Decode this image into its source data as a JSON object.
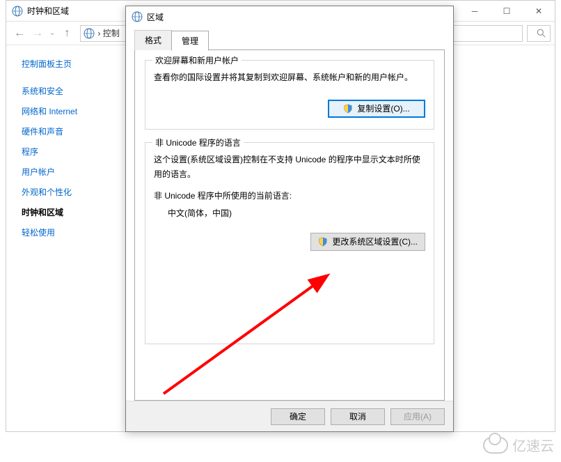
{
  "cp": {
    "title": "时钟和区域",
    "breadcrumb": "控制",
    "home": "控制面板主页",
    "items": [
      {
        "label": "系统和安全",
        "active": false
      },
      {
        "label": "网络和 Internet",
        "active": false
      },
      {
        "label": "硬件和声音",
        "active": false
      },
      {
        "label": "程序",
        "active": false
      },
      {
        "label": "用户帐户",
        "active": false
      },
      {
        "label": "外观和个性化",
        "active": false
      },
      {
        "label": "时钟和区域",
        "active": true
      },
      {
        "label": "轻松使用",
        "active": false
      }
    ]
  },
  "dialog": {
    "title": "区域",
    "tabs": [
      {
        "label": "格式",
        "active": false
      },
      {
        "label": "管理",
        "active": true
      }
    ],
    "group1": {
      "legend": "欢迎屏幕和新用户帐户",
      "text": "查看你的国际设置并将其复制到欢迎屏幕、系统帐户和新的用户帐户。",
      "button": "复制设置(O)..."
    },
    "group2": {
      "legend": "非 Unicode 程序的语言",
      "text": "这个设置(系统区域设置)控制在不支持 Unicode 的程序中显示文本时所使用的语言。",
      "current_label": "非 Unicode 程序中所使用的当前语言:",
      "current_value": "中文(简体，中国)",
      "button": "更改系统区域设置(C)..."
    },
    "footer": {
      "ok": "确定",
      "cancel": "取消",
      "apply": "应用(A)"
    }
  },
  "watermark": "亿速云"
}
